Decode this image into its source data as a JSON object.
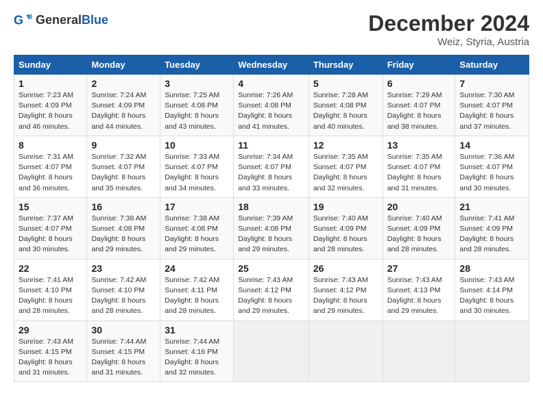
{
  "header": {
    "logo_general": "General",
    "logo_blue": "Blue",
    "month_title": "December 2024",
    "subtitle": "Weiz, Styria, Austria"
  },
  "weekdays": [
    "Sunday",
    "Monday",
    "Tuesday",
    "Wednesday",
    "Thursday",
    "Friday",
    "Saturday"
  ],
  "weeks": [
    [
      {
        "day": "1",
        "sunrise": "7:23 AM",
        "sunset": "4:09 PM",
        "daylight": "8 hours and 46 minutes."
      },
      {
        "day": "2",
        "sunrise": "7:24 AM",
        "sunset": "4:09 PM",
        "daylight": "8 hours and 44 minutes."
      },
      {
        "day": "3",
        "sunrise": "7:25 AM",
        "sunset": "4:08 PM",
        "daylight": "8 hours and 43 minutes."
      },
      {
        "day": "4",
        "sunrise": "7:26 AM",
        "sunset": "4:08 PM",
        "daylight": "8 hours and 41 minutes."
      },
      {
        "day": "5",
        "sunrise": "7:28 AM",
        "sunset": "4:08 PM",
        "daylight": "8 hours and 40 minutes."
      },
      {
        "day": "6",
        "sunrise": "7:29 AM",
        "sunset": "4:07 PM",
        "daylight": "8 hours and 38 minutes."
      },
      {
        "day": "7",
        "sunrise": "7:30 AM",
        "sunset": "4:07 PM",
        "daylight": "8 hours and 37 minutes."
      }
    ],
    [
      {
        "day": "8",
        "sunrise": "7:31 AM",
        "sunset": "4:07 PM",
        "daylight": "8 hours and 36 minutes."
      },
      {
        "day": "9",
        "sunrise": "7:32 AM",
        "sunset": "4:07 PM",
        "daylight": "8 hours and 35 minutes."
      },
      {
        "day": "10",
        "sunrise": "7:33 AM",
        "sunset": "4:07 PM",
        "daylight": "8 hours and 34 minutes."
      },
      {
        "day": "11",
        "sunrise": "7:34 AM",
        "sunset": "4:07 PM",
        "daylight": "8 hours and 33 minutes."
      },
      {
        "day": "12",
        "sunrise": "7:35 AM",
        "sunset": "4:07 PM",
        "daylight": "8 hours and 32 minutes."
      },
      {
        "day": "13",
        "sunrise": "7:35 AM",
        "sunset": "4:07 PM",
        "daylight": "8 hours and 31 minutes."
      },
      {
        "day": "14",
        "sunrise": "7:36 AM",
        "sunset": "4:07 PM",
        "daylight": "8 hours and 30 minutes."
      }
    ],
    [
      {
        "day": "15",
        "sunrise": "7:37 AM",
        "sunset": "4:07 PM",
        "daylight": "8 hours and 30 minutes."
      },
      {
        "day": "16",
        "sunrise": "7:38 AM",
        "sunset": "4:08 PM",
        "daylight": "8 hours and 29 minutes."
      },
      {
        "day": "17",
        "sunrise": "7:38 AM",
        "sunset": "4:08 PM",
        "daylight": "8 hours and 29 minutes."
      },
      {
        "day": "18",
        "sunrise": "7:39 AM",
        "sunset": "4:08 PM",
        "daylight": "8 hours and 29 minutes."
      },
      {
        "day": "19",
        "sunrise": "7:40 AM",
        "sunset": "4:09 PM",
        "daylight": "8 hours and 28 minutes."
      },
      {
        "day": "20",
        "sunrise": "7:40 AM",
        "sunset": "4:09 PM",
        "daylight": "8 hours and 28 minutes."
      },
      {
        "day": "21",
        "sunrise": "7:41 AM",
        "sunset": "4:09 PM",
        "daylight": "8 hours and 28 minutes."
      }
    ],
    [
      {
        "day": "22",
        "sunrise": "7:41 AM",
        "sunset": "4:10 PM",
        "daylight": "8 hours and 28 minutes."
      },
      {
        "day": "23",
        "sunrise": "7:42 AM",
        "sunset": "4:10 PM",
        "daylight": "8 hours and 28 minutes."
      },
      {
        "day": "24",
        "sunrise": "7:42 AM",
        "sunset": "4:11 PM",
        "daylight": "8 hours and 28 minutes."
      },
      {
        "day": "25",
        "sunrise": "7:43 AM",
        "sunset": "4:12 PM",
        "daylight": "8 hours and 29 minutes."
      },
      {
        "day": "26",
        "sunrise": "7:43 AM",
        "sunset": "4:12 PM",
        "daylight": "8 hours and 29 minutes."
      },
      {
        "day": "27",
        "sunrise": "7:43 AM",
        "sunset": "4:13 PM",
        "daylight": "8 hours and 29 minutes."
      },
      {
        "day": "28",
        "sunrise": "7:43 AM",
        "sunset": "4:14 PM",
        "daylight": "8 hours and 30 minutes."
      }
    ],
    [
      {
        "day": "29",
        "sunrise": "7:43 AM",
        "sunset": "4:15 PM",
        "daylight": "8 hours and 31 minutes."
      },
      {
        "day": "30",
        "sunrise": "7:44 AM",
        "sunset": "4:15 PM",
        "daylight": "8 hours and 31 minutes."
      },
      {
        "day": "31",
        "sunrise": "7:44 AM",
        "sunset": "4:16 PM",
        "daylight": "8 hours and 32 minutes."
      },
      null,
      null,
      null,
      null
    ]
  ]
}
